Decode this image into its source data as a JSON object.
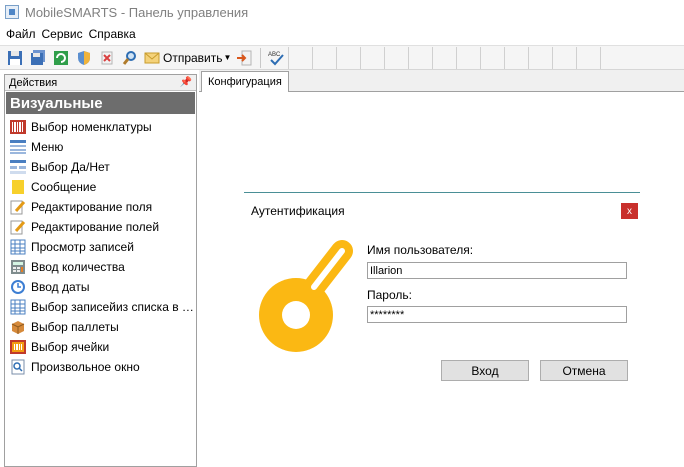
{
  "window": {
    "title": "MobileSMARTS - Панель управления"
  },
  "menu": {
    "items": [
      "Файл",
      "Сервис",
      "Справка"
    ]
  },
  "toolbar": {
    "send_label": "Отправить"
  },
  "left_panel": {
    "header": "Действия",
    "section": "Визуальные",
    "items": [
      "Выбор номенклатуры",
      "Меню",
      "Выбор Да/Нет",
      "Сообщение",
      "Редактирование поля",
      "Редактирование полей",
      "Просмотр записей",
      "Ввод количества",
      "Ввод даты",
      "Выбор записейиз списка в сп...",
      "Выбор паллеты",
      "Выбор ячейки",
      "Произвольное окно"
    ]
  },
  "tabs": {
    "active": "Конфигурация"
  },
  "dialog": {
    "title": "Аутентификация",
    "close": "x",
    "username_label": "Имя пользователя:",
    "username_value": "Illarion",
    "password_label": "Пароль:",
    "password_value": "********",
    "ok_label": "Вход",
    "cancel_label": "Отмена",
    "accent_color": "#fbb813"
  }
}
